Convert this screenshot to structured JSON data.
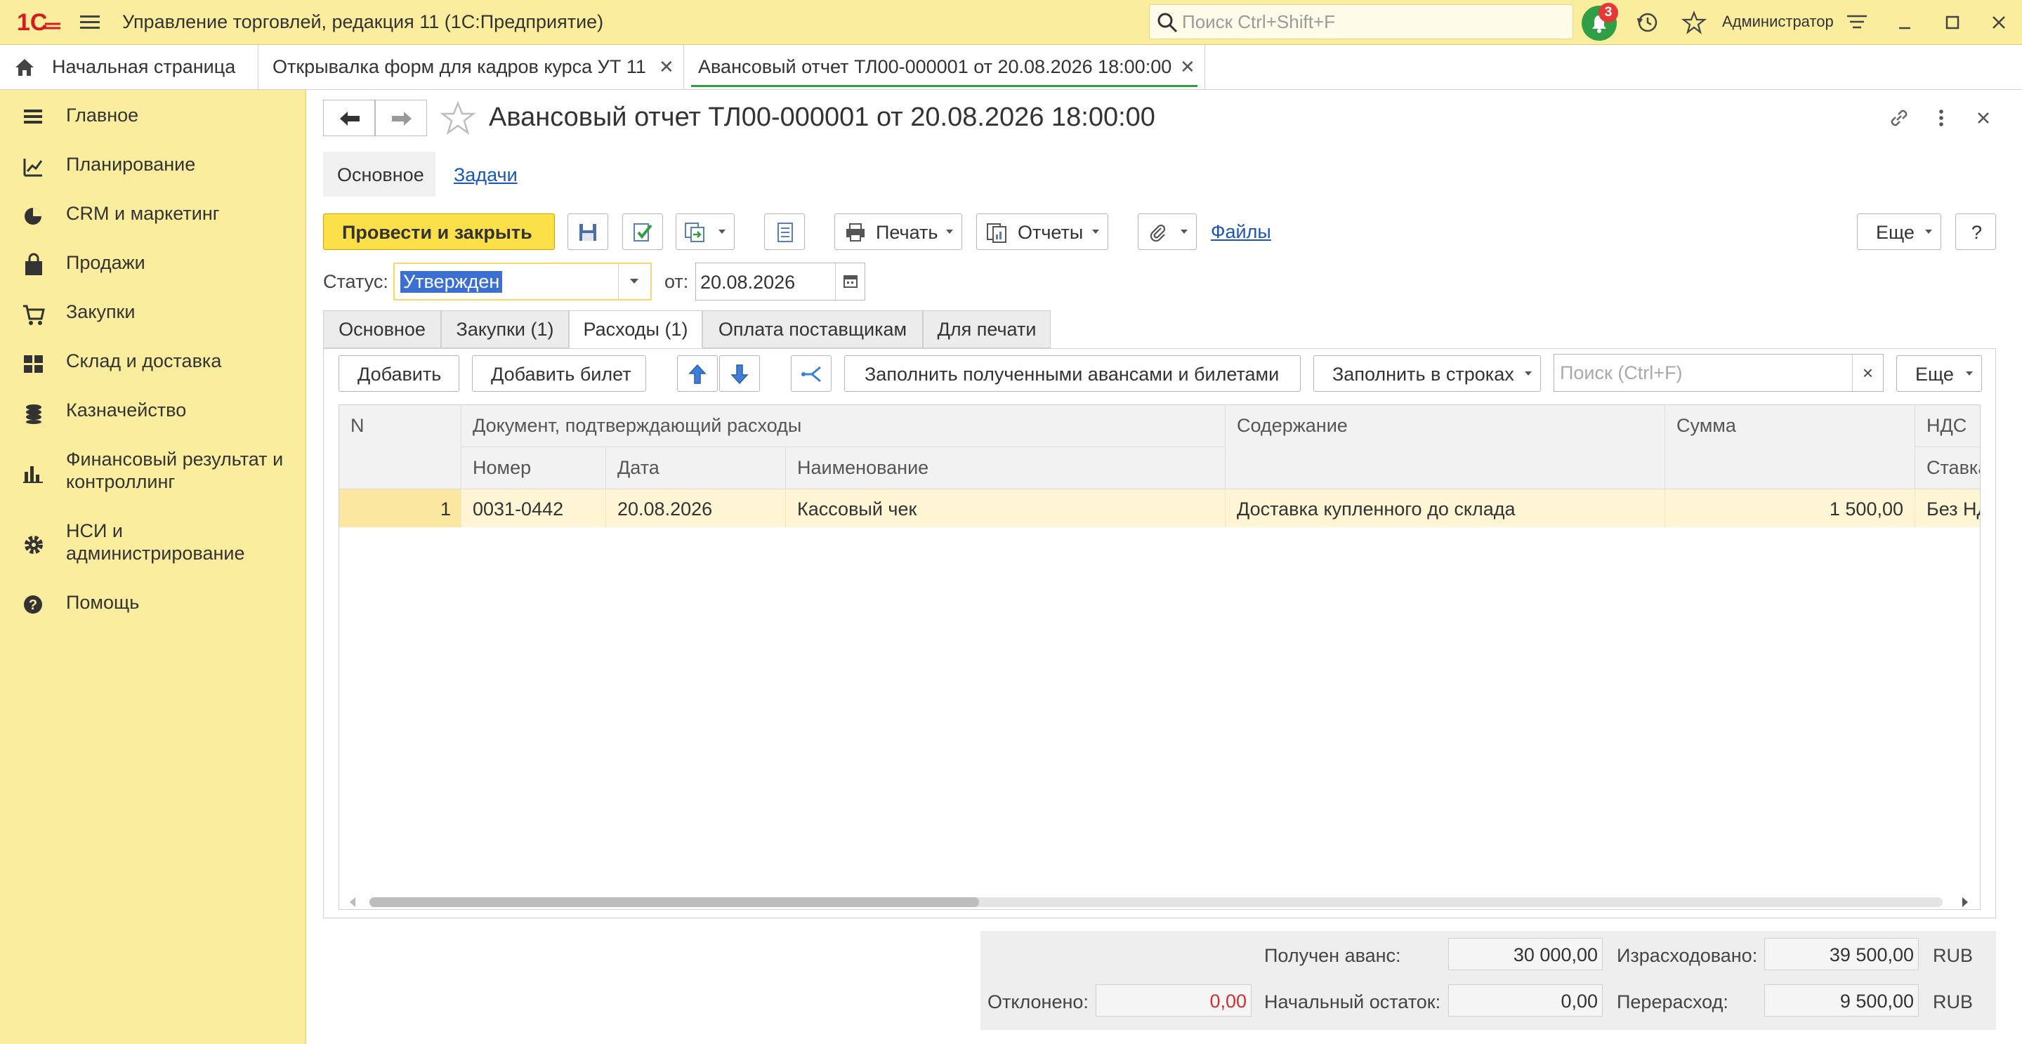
{
  "app": {
    "title": "Управление торговлей, редакция 11  (1С:Предприятие)",
    "search_placeholder": "Поиск Ctrl+Shift+F",
    "notifications_count": "3",
    "user": "Администратор"
  },
  "window_tabs": [
    {
      "label": "Начальная страница"
    },
    {
      "label": "Открывалка форм для кадров курса УТ 11"
    },
    {
      "label": "Авансовый отчет ТЛ00-000001 от 20.08.2026 18:00:00"
    }
  ],
  "sidebar": {
    "items": [
      {
        "label": "Главное",
        "icon": "menu-lines-icon"
      },
      {
        "label": "Планирование",
        "icon": "planning-icon"
      },
      {
        "label": "CRM и маркетинг",
        "icon": "pie-chart-icon"
      },
      {
        "label": "Продажи",
        "icon": "shopping-bag-icon"
      },
      {
        "label": "Закупки",
        "icon": "cart-icon"
      },
      {
        "label": "Склад и доставка",
        "icon": "warehouse-icon"
      },
      {
        "label": "Казначейство",
        "icon": "coins-icon"
      },
      {
        "label": "Финансовый результат и контроллинг",
        "icon": "bar-chart-icon"
      },
      {
        "label": "НСИ и администрирование",
        "icon": "gear-icon"
      },
      {
        "label": "Помощь",
        "icon": "help-icon"
      }
    ]
  },
  "form": {
    "title": "Авансовый отчет ТЛ00-000001 от 20.08.2026 18:00:00",
    "subtabs": {
      "main": "Основное",
      "tasks": "Задачи"
    },
    "toolbar": {
      "post_close": "Провести и закрыть",
      "print": "Печать",
      "reports": "Отчеты",
      "files": "Файлы",
      "more": "Еще",
      "help": "?"
    },
    "status_label": "Статус:",
    "status_value": "Утвержден",
    "date_label": "от:",
    "date_value": "20.08.2026",
    "page_tabs": [
      "Основное",
      "Закупки (1)",
      "Расходы (1)",
      "Оплата поставщикам",
      "Для печати"
    ],
    "table_toolbar": {
      "add": "Добавить",
      "add_ticket": "Добавить билет",
      "fill_advances": "Заполнить полученными авансами и билетами",
      "fill_rows": "Заполнить в строках",
      "search_placeholder": "Поиск (Ctrl+F)",
      "clear": "×",
      "more": "Еще"
    },
    "table": {
      "headers": {
        "n": "N",
        "doc": "Документ, подтверждающий расходы",
        "content": "Содержание",
        "sum": "Сумма",
        "vat": "НДС",
        "number": "Номер",
        "date": "Дата",
        "name": "Наименование",
        "rate": "Ставка"
      },
      "rows": [
        {
          "n": "1",
          "number": "0031-0442",
          "date": "20.08.2026",
          "name": "Кассовый чек",
          "content": "Доставка купленного до склада",
          "sum": "1 500,00",
          "vat": "Без НДС"
        }
      ]
    },
    "totals": {
      "received_label": "Получен аванс:",
      "received_value": "30 000,00",
      "spent_label": "Израсходовано:",
      "spent_value": "39 500,00",
      "rejected_label": "Отклонено:",
      "rejected_value": "0,00",
      "opening_label": "Начальный остаток:",
      "opening_value": "0,00",
      "overspend_label": "Перерасход:",
      "overspend_value": "9 500,00",
      "currency": "RUB"
    }
  }
}
